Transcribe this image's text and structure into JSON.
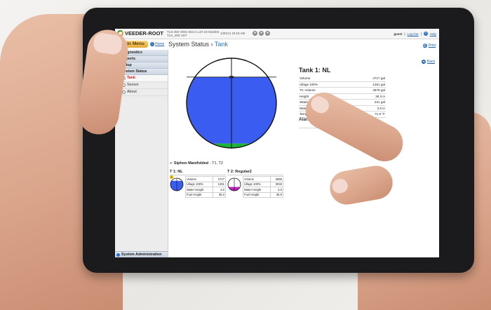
{
  "topbar": {
    "logo": "VEEDER-ROOT",
    "system_line1": "TLS-450 V001-004.G.137.24-816304",
    "system_line2": "TLS_450 UST",
    "datetime": "1/30/14 10:18 AM",
    "user": "guest",
    "logout": "Log Out",
    "help": "Help"
  },
  "header": {
    "main_menu": "Main Menu",
    "home": "Home",
    "breadcrumb_root": "System Status",
    "breadcrumb_sep": "›",
    "breadcrumb_current": "Tank",
    "print": "Print"
  },
  "sidebar": {
    "sections": [
      {
        "label": "Diagnostics"
      },
      {
        "label": "Reports"
      },
      {
        "label": "Setup"
      },
      {
        "label": "System Status"
      }
    ],
    "items": [
      {
        "label": "Tank"
      },
      {
        "label": "Sensor"
      },
      {
        "label": "About"
      }
    ],
    "footer": "System Administration"
  },
  "tank": {
    "title": "Tank 1: NL",
    "back": "Back",
    "details": [
      {
        "label": "Volume",
        "value": "4717 gal"
      },
      {
        "label": "Ullage 100%",
        "value": "1251 gal"
      },
      {
        "label": "TC Volume",
        "value": "4678 gal"
      },
      {
        "label": "Height",
        "value": "38.3 in"
      },
      {
        "label": "Water Volume",
        "value": "221 gal"
      },
      {
        "label": "Water Height",
        "value": "3.0 in"
      },
      {
        "label": "Temperature",
        "value": "71.9 °F"
      }
    ],
    "fill_fraction": 0.79,
    "water_fraction": 0.05,
    "colors": {
      "product": "#3b5cf0",
      "water": "#1db33a",
      "ullage": "#ffffff"
    },
    "alarms_title": "Alarms / Warnings",
    "alarms_col_product": "Product"
  },
  "siphon": {
    "label": "Siphon Manifolded",
    "tanks": ": T1, T2"
  },
  "mini_tanks": [
    {
      "title": "T 1: NL",
      "fill_color": "#3b5cf0",
      "fill_fraction": 0.79,
      "rows": [
        {
          "label": "Volume",
          "value": "4717"
        },
        {
          "label": "Ullage 100%",
          "value": "1251"
        },
        {
          "label": "Water Height",
          "value": "3.0"
        },
        {
          "label": "Fuel Height",
          "value": "38.3"
        }
      ]
    },
    {
      "title": "T 2: Regular2",
      "fill_color": "#c21ec2",
      "fill_fraction": 0.3,
      "rows": [
        {
          "label": "Volume",
          "value": "2966"
        },
        {
          "label": "Ullage 100%",
          "value": "3032"
        },
        {
          "label": "Water Height",
          "value": "3.0"
        },
        {
          "label": "Fuel Height",
          "value": "36.9"
        }
      ]
    }
  ]
}
